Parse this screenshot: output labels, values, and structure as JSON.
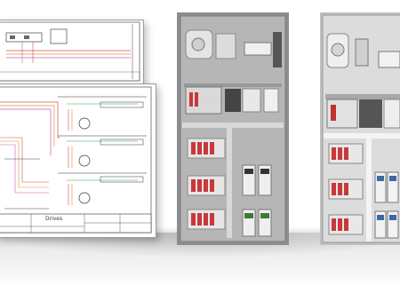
{
  "drawing": {
    "title_block_label": "Drives"
  },
  "colors": {
    "wire_red": "#d0514c",
    "wire_orange": "#e48a3a",
    "wire_magenta": "#c060b8",
    "wire_green": "#3a9a4a",
    "cabinet_grey": "#8d8d8d",
    "panel_grey": "#b6b6b6",
    "breaker_red": "#c9383a"
  }
}
